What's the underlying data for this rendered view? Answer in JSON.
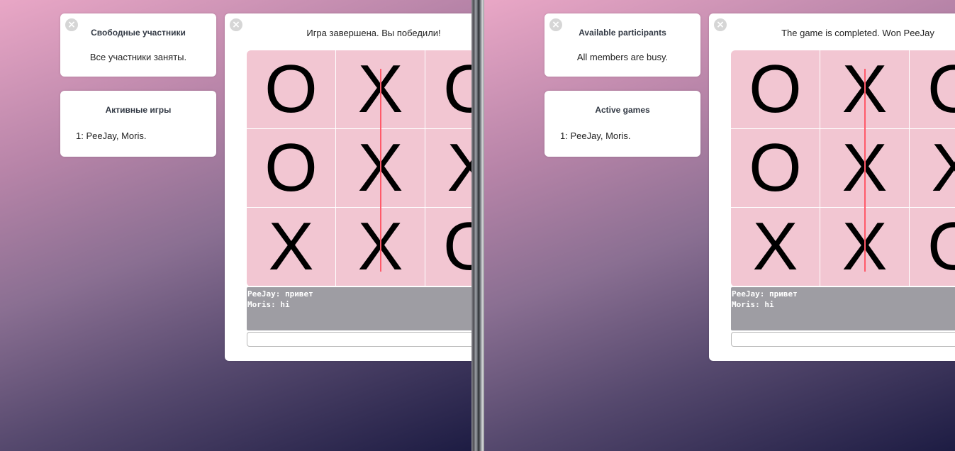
{
  "panes": [
    {
      "lang": "ru",
      "free_title": "Свободные участники",
      "free_text": "Все участники заняты.",
      "active_title": "Активные игры",
      "active_row": "1: PeeJay, Moris.",
      "status": "Игра завершена. Вы победили!",
      "board": [
        "O",
        "X",
        "O",
        "O",
        "X",
        "X",
        "X",
        "X",
        "O"
      ],
      "chat": [
        "PeeJay: привет",
        "Moris: hi"
      ],
      "input_value": ""
    },
    {
      "lang": "en",
      "free_title": "Available participants",
      "free_text": "All members are busy.",
      "active_title": "Active games",
      "active_row": "1: PeeJay, Moris.",
      "status": "The game is completed. Won PeeJay",
      "board": [
        "O",
        "X",
        "O",
        "O",
        "X",
        "X",
        "X",
        "X",
        "O"
      ],
      "chat": [
        "PeeJay: привет",
        "Moris: hi"
      ],
      "input_value": ""
    }
  ],
  "icons": {
    "close": "close-icon"
  },
  "colors": {
    "board": "#f2c6d2",
    "win_line": "#ff5a6a",
    "chat_bg": "#9e9da3"
  }
}
